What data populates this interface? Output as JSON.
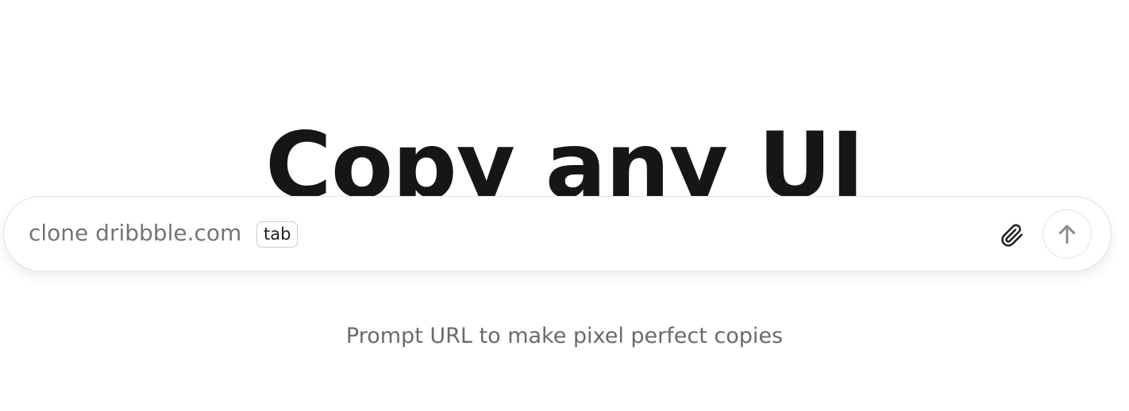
{
  "hero": {
    "title": "Copy any UI"
  },
  "prompt": {
    "placeholder": "clone dribbble.com",
    "key_hint": "tab",
    "attach_icon": "paperclip-icon",
    "send_icon": "arrow-up-icon"
  },
  "caption": {
    "text": "Prompt URL to make pixel perfect copies"
  },
  "colors": {
    "title": "#161616",
    "placeholder": "#757575",
    "caption": "#6a6a6a",
    "border": "#e3e3e3",
    "icon_muted": "#8a8a8a",
    "icon_dark": "#1f1f1f"
  }
}
